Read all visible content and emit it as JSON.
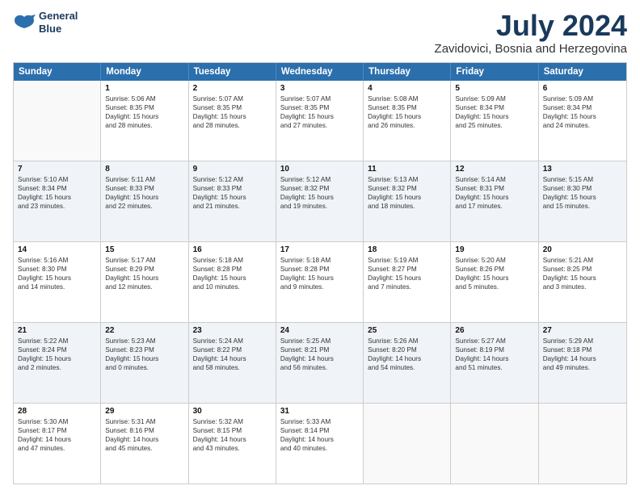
{
  "logo": {
    "line1": "General",
    "line2": "Blue"
  },
  "title": "July 2024",
  "subtitle": "Zavidovici, Bosnia and Herzegovina",
  "days": [
    "Sunday",
    "Monday",
    "Tuesday",
    "Wednesday",
    "Thursday",
    "Friday",
    "Saturday"
  ],
  "weeks": [
    [
      {
        "day": "",
        "lines": []
      },
      {
        "day": "1",
        "lines": [
          "Sunrise: 5:06 AM",
          "Sunset: 8:35 PM",
          "Daylight: 15 hours",
          "and 28 minutes."
        ]
      },
      {
        "day": "2",
        "lines": [
          "Sunrise: 5:07 AM",
          "Sunset: 8:35 PM",
          "Daylight: 15 hours",
          "and 28 minutes."
        ]
      },
      {
        "day": "3",
        "lines": [
          "Sunrise: 5:07 AM",
          "Sunset: 8:35 PM",
          "Daylight: 15 hours",
          "and 27 minutes."
        ]
      },
      {
        "day": "4",
        "lines": [
          "Sunrise: 5:08 AM",
          "Sunset: 8:35 PM",
          "Daylight: 15 hours",
          "and 26 minutes."
        ]
      },
      {
        "day": "5",
        "lines": [
          "Sunrise: 5:09 AM",
          "Sunset: 8:34 PM",
          "Daylight: 15 hours",
          "and 25 minutes."
        ]
      },
      {
        "day": "6",
        "lines": [
          "Sunrise: 5:09 AM",
          "Sunset: 8:34 PM",
          "Daylight: 15 hours",
          "and 24 minutes."
        ]
      }
    ],
    [
      {
        "day": "7",
        "lines": [
          "Sunrise: 5:10 AM",
          "Sunset: 8:34 PM",
          "Daylight: 15 hours",
          "and 23 minutes."
        ]
      },
      {
        "day": "8",
        "lines": [
          "Sunrise: 5:11 AM",
          "Sunset: 8:33 PM",
          "Daylight: 15 hours",
          "and 22 minutes."
        ]
      },
      {
        "day": "9",
        "lines": [
          "Sunrise: 5:12 AM",
          "Sunset: 8:33 PM",
          "Daylight: 15 hours",
          "and 21 minutes."
        ]
      },
      {
        "day": "10",
        "lines": [
          "Sunrise: 5:12 AM",
          "Sunset: 8:32 PM",
          "Daylight: 15 hours",
          "and 19 minutes."
        ]
      },
      {
        "day": "11",
        "lines": [
          "Sunrise: 5:13 AM",
          "Sunset: 8:32 PM",
          "Daylight: 15 hours",
          "and 18 minutes."
        ]
      },
      {
        "day": "12",
        "lines": [
          "Sunrise: 5:14 AM",
          "Sunset: 8:31 PM",
          "Daylight: 15 hours",
          "and 17 minutes."
        ]
      },
      {
        "day": "13",
        "lines": [
          "Sunrise: 5:15 AM",
          "Sunset: 8:30 PM",
          "Daylight: 15 hours",
          "and 15 minutes."
        ]
      }
    ],
    [
      {
        "day": "14",
        "lines": [
          "Sunrise: 5:16 AM",
          "Sunset: 8:30 PM",
          "Daylight: 15 hours",
          "and 14 minutes."
        ]
      },
      {
        "day": "15",
        "lines": [
          "Sunrise: 5:17 AM",
          "Sunset: 8:29 PM",
          "Daylight: 15 hours",
          "and 12 minutes."
        ]
      },
      {
        "day": "16",
        "lines": [
          "Sunrise: 5:18 AM",
          "Sunset: 8:28 PM",
          "Daylight: 15 hours",
          "and 10 minutes."
        ]
      },
      {
        "day": "17",
        "lines": [
          "Sunrise: 5:18 AM",
          "Sunset: 8:28 PM",
          "Daylight: 15 hours",
          "and 9 minutes."
        ]
      },
      {
        "day": "18",
        "lines": [
          "Sunrise: 5:19 AM",
          "Sunset: 8:27 PM",
          "Daylight: 15 hours",
          "and 7 minutes."
        ]
      },
      {
        "day": "19",
        "lines": [
          "Sunrise: 5:20 AM",
          "Sunset: 8:26 PM",
          "Daylight: 15 hours",
          "and 5 minutes."
        ]
      },
      {
        "day": "20",
        "lines": [
          "Sunrise: 5:21 AM",
          "Sunset: 8:25 PM",
          "Daylight: 15 hours",
          "and 3 minutes."
        ]
      }
    ],
    [
      {
        "day": "21",
        "lines": [
          "Sunrise: 5:22 AM",
          "Sunset: 8:24 PM",
          "Daylight: 15 hours",
          "and 2 minutes."
        ]
      },
      {
        "day": "22",
        "lines": [
          "Sunrise: 5:23 AM",
          "Sunset: 8:23 PM",
          "Daylight: 15 hours",
          "and 0 minutes."
        ]
      },
      {
        "day": "23",
        "lines": [
          "Sunrise: 5:24 AM",
          "Sunset: 8:22 PM",
          "Daylight: 14 hours",
          "and 58 minutes."
        ]
      },
      {
        "day": "24",
        "lines": [
          "Sunrise: 5:25 AM",
          "Sunset: 8:21 PM",
          "Daylight: 14 hours",
          "and 56 minutes."
        ]
      },
      {
        "day": "25",
        "lines": [
          "Sunrise: 5:26 AM",
          "Sunset: 8:20 PM",
          "Daylight: 14 hours",
          "and 54 minutes."
        ]
      },
      {
        "day": "26",
        "lines": [
          "Sunrise: 5:27 AM",
          "Sunset: 8:19 PM",
          "Daylight: 14 hours",
          "and 51 minutes."
        ]
      },
      {
        "day": "27",
        "lines": [
          "Sunrise: 5:29 AM",
          "Sunset: 8:18 PM",
          "Daylight: 14 hours",
          "and 49 minutes."
        ]
      }
    ],
    [
      {
        "day": "28",
        "lines": [
          "Sunrise: 5:30 AM",
          "Sunset: 8:17 PM",
          "Daylight: 14 hours",
          "and 47 minutes."
        ]
      },
      {
        "day": "29",
        "lines": [
          "Sunrise: 5:31 AM",
          "Sunset: 8:16 PM",
          "Daylight: 14 hours",
          "and 45 minutes."
        ]
      },
      {
        "day": "30",
        "lines": [
          "Sunrise: 5:32 AM",
          "Sunset: 8:15 PM",
          "Daylight: 14 hours",
          "and 43 minutes."
        ]
      },
      {
        "day": "31",
        "lines": [
          "Sunrise: 5:33 AM",
          "Sunset: 8:14 PM",
          "Daylight: 14 hours",
          "and 40 minutes."
        ]
      },
      {
        "day": "",
        "lines": []
      },
      {
        "day": "",
        "lines": []
      },
      {
        "day": "",
        "lines": []
      }
    ]
  ]
}
